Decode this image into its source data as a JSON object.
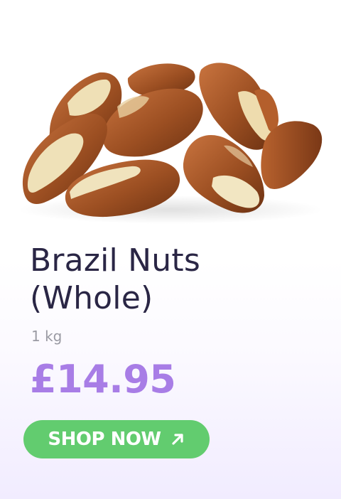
{
  "product": {
    "image_icon": "brazil-nuts-image",
    "title": "Brazil Nuts\n(Whole)",
    "weight": "1 kg",
    "price": "£14.95",
    "cta_label": "SHOP NOW",
    "cta_icon": "arrow-up-right-icon"
  },
  "colors": {
    "title": "#2a2645",
    "price": "#a87de6",
    "button": "#62cc6f",
    "weight": "#9a9aa3"
  }
}
